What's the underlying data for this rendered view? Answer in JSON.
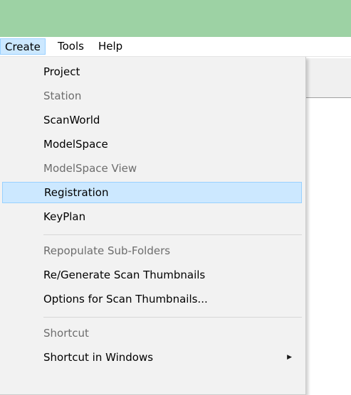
{
  "menubar": {
    "items": [
      {
        "label": "Create",
        "active": true
      },
      {
        "label": "Tools",
        "active": false
      },
      {
        "label": "Help",
        "active": false
      }
    ]
  },
  "create_menu": {
    "items": [
      {
        "label": "Project",
        "enabled": true
      },
      {
        "label": "Station",
        "enabled": false
      },
      {
        "label": "ScanWorld",
        "enabled": true
      },
      {
        "label": "ModelSpace",
        "enabled": true
      },
      {
        "label": "ModelSpace View",
        "enabled": false
      },
      {
        "label": "Registration",
        "enabled": true,
        "highlighted": true
      },
      {
        "label": "KeyPlan",
        "enabled": true
      },
      {
        "label": "Repopulate Sub-Folders",
        "enabled": false
      },
      {
        "label": "Re/Generate Scan Thumbnails",
        "enabled": true
      },
      {
        "label": "Options for Scan Thumbnails...",
        "enabled": true
      },
      {
        "label": "Shortcut",
        "enabled": false
      },
      {
        "label": "Shortcut in Windows",
        "enabled": true,
        "has_submenu": true,
        "submenu_icon": "triangle-right-icon"
      }
    ]
  },
  "colors": {
    "titlebar": "#9dd2a4",
    "highlight_fill": "#cce8ff",
    "highlight_border": "#99d1ff",
    "menu_background": "#f2f2f2",
    "disabled_text": "#6d6d6d"
  }
}
